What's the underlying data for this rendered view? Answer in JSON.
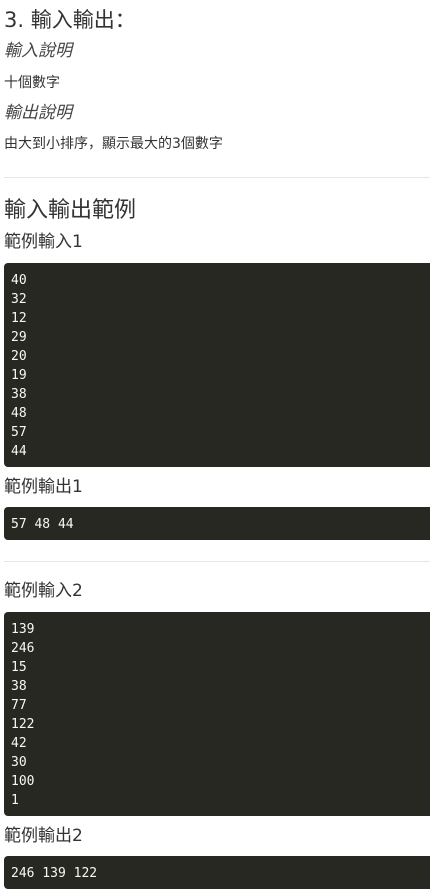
{
  "io": {
    "heading": "3. 輸入輸出：",
    "input_desc_title": "輸入說明",
    "input_desc": "十個數字",
    "output_desc_title": "輸出說明",
    "output_desc": "由大到小排序，顯示最大的3個數字"
  },
  "examples": {
    "heading": "輸入輸出範例",
    "sample1": {
      "input_title": "範例輸入1",
      "input_lines": [
        "40",
        "32",
        "12",
        "29",
        "20",
        "19",
        "38",
        "48",
        "57",
        "44"
      ],
      "output_title": "範例輸出1",
      "output": "57 48 44"
    },
    "sample2": {
      "input_title": "範例輸入2",
      "input_lines": [
        "139",
        "246",
        "15",
        "38",
        "77",
        "122",
        "42",
        "30",
        "100",
        "1"
      ],
      "output_title": "範例輸出2",
      "output": "246 139 122"
    }
  }
}
